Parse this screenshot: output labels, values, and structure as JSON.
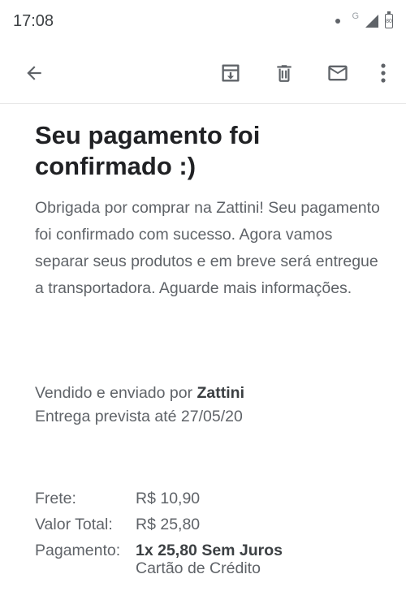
{
  "status_bar": {
    "time": "17:08",
    "network": "G",
    "battery": "80"
  },
  "toolbar": {
    "back_icon": "arrow-back-icon",
    "archive_icon": "archive-icon",
    "delete_icon": "trash-icon",
    "mark_unread_icon": "mail-icon",
    "more_icon": "more-vert-icon"
  },
  "email": {
    "title": "Seu pagamento foi confirmado :)",
    "body": "Obrigada por comprar na Zattini! Seu pagamento foi confirmado com sucesso. Agora vamos separar seus produtos e em breve será entregue a transportadora. Aguarde mais informações.",
    "seller_prefix": "Vendido e enviado por",
    "seller_name": "Zattini",
    "delivery": "Entrega prevista até 27/05/20",
    "summary": {
      "frete_label": "Frete:",
      "frete_value": "R$ 10,90",
      "total_label": "Valor Total:",
      "total_value": "R$ 25,80",
      "payment_label": "Pagamento:",
      "payment_value": "1x 25,80 Sem Juros",
      "payment_method": "Cartão de Crédito"
    }
  },
  "colors": {
    "text_dark": "#202124",
    "text_muted": "#5f6368",
    "icon": "#5f6368"
  }
}
